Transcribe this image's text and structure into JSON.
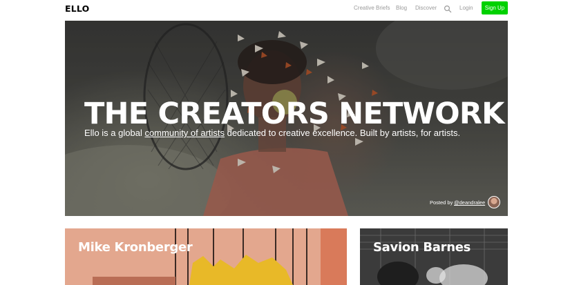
{
  "header": {
    "logo": "ELLO",
    "nav": {
      "creative_briefs": "Creative Briefs",
      "blog": "Blog",
      "discover": "Discover",
      "login": "Login",
      "signup": "Sign Up"
    },
    "search_icon": "search-icon",
    "accent_color": "#00d100"
  },
  "hero": {
    "title": "THE CREATORS NETWORK",
    "subtitle_before": "Ello is a global ",
    "subtitle_link": "community of artists",
    "subtitle_after": " dedicated to creative excellence. Built by artists, for artists.",
    "posted_by_label": "Posted by",
    "posted_by_handle": "@deandralee"
  },
  "cards": [
    {
      "name": "Mike Kronberger"
    },
    {
      "name": "Savion Barnes"
    }
  ]
}
